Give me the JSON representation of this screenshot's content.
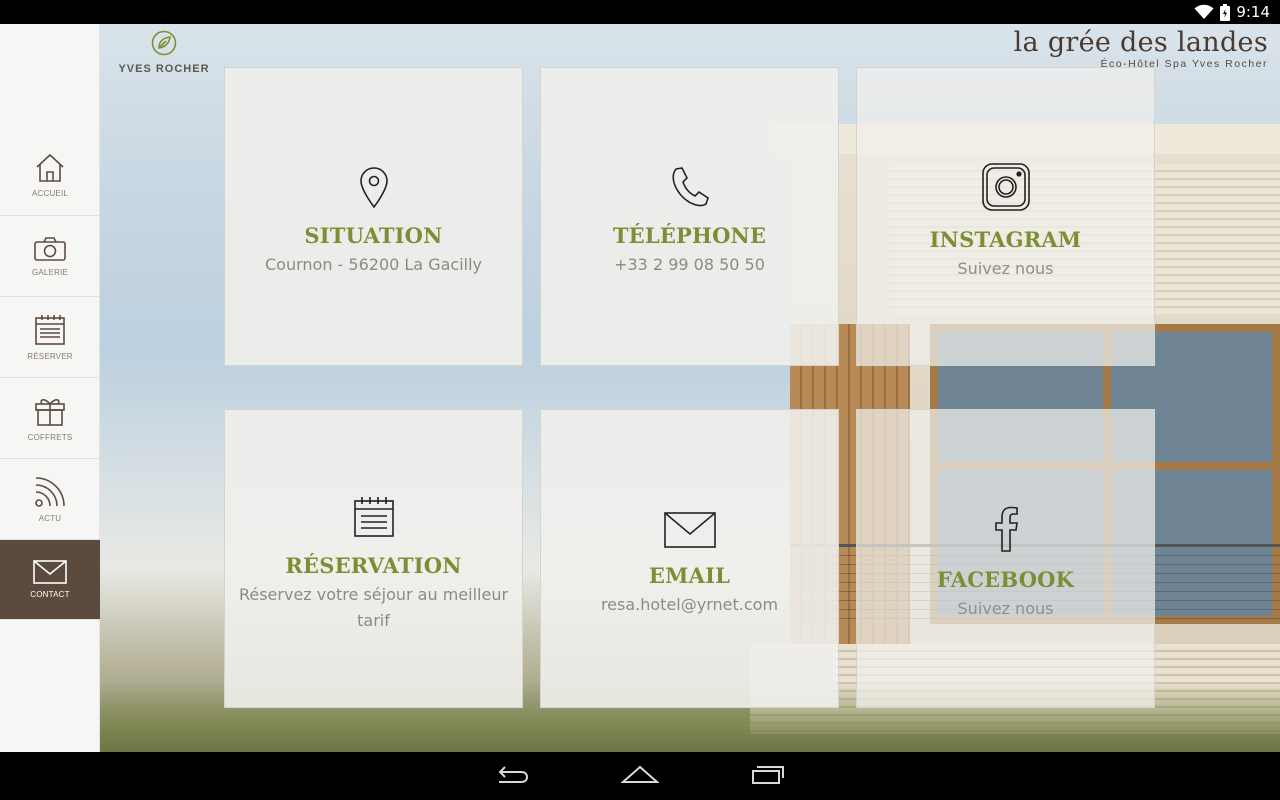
{
  "status_bar": {
    "time": "9:14"
  },
  "brand": {
    "name": "YVES ROCHER"
  },
  "hotel": {
    "title": "la grée des landes",
    "subtitle": "Éco-Hôtel Spa Yves Rocher"
  },
  "sidebar": {
    "items": [
      {
        "label": "ACCUEIL",
        "icon": "home-icon",
        "active": false
      },
      {
        "label": "GALERIE",
        "icon": "camera-icon",
        "active": false
      },
      {
        "label": "RÉSERVER",
        "icon": "calendar-icon",
        "active": false
      },
      {
        "label": "COFFRETS",
        "icon": "gift-icon",
        "active": false
      },
      {
        "label": "ACTU",
        "icon": "rss-icon",
        "active": false
      },
      {
        "label": "CONTACT",
        "icon": "envelope-icon",
        "active": true
      }
    ]
  },
  "tiles": [
    {
      "title": "SITUATION",
      "desc": "Cournon - 56200 La Gacilly",
      "icon": "location-pin-icon"
    },
    {
      "title": "TÉLÉPHONE",
      "desc": "+33 2 99 08 50 50",
      "icon": "phone-icon"
    },
    {
      "title": "INSTAGRAM",
      "desc": "Suivez nous",
      "icon": "instagram-icon"
    },
    {
      "title": "RÉSERVATION",
      "desc": "Réservez votre séjour au meilleur tarif",
      "icon": "calendar-icon"
    },
    {
      "title": "EMAIL",
      "desc": "resa.hotel@yrnet.com",
      "icon": "envelope-icon"
    },
    {
      "title": "FACEBOOK",
      "desc": "Suivez nous",
      "icon": "facebook-icon"
    }
  ],
  "colors": {
    "accent": "#7d8f35",
    "sidebar_active": "#5b4a3d",
    "brown": "#5f4b3e"
  }
}
